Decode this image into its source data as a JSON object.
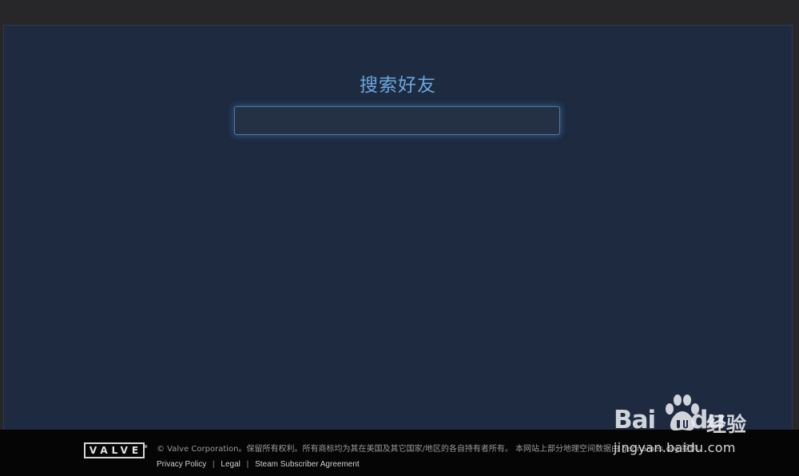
{
  "page": {
    "title": "搜索好友",
    "search": {
      "value": "",
      "placeholder": ""
    }
  },
  "footer": {
    "logo_text": "VALVE",
    "copyright": "© Valve Corporation。保留所有权利。所有商标均为其在美国及其它国家/地区的各自持有者所有。 本网站上部分地理空间数据由 geonames.org 提供。",
    "links": [
      {
        "label": "Privacy Policy"
      },
      {
        "label": "Legal"
      },
      {
        "label": "Steam Subscriber Agreement"
      }
    ],
    "separator": "|"
  },
  "watermark": {
    "brand": "Bai",
    "brand_suffix": "du",
    "product": "经验",
    "url": "jingyan.baidu.com"
  },
  "colors": {
    "panel_bg": "#1d2a3f",
    "title": "#6aa7e0",
    "footer_bg": "#050505",
    "input_border": "#4c7ba6"
  }
}
